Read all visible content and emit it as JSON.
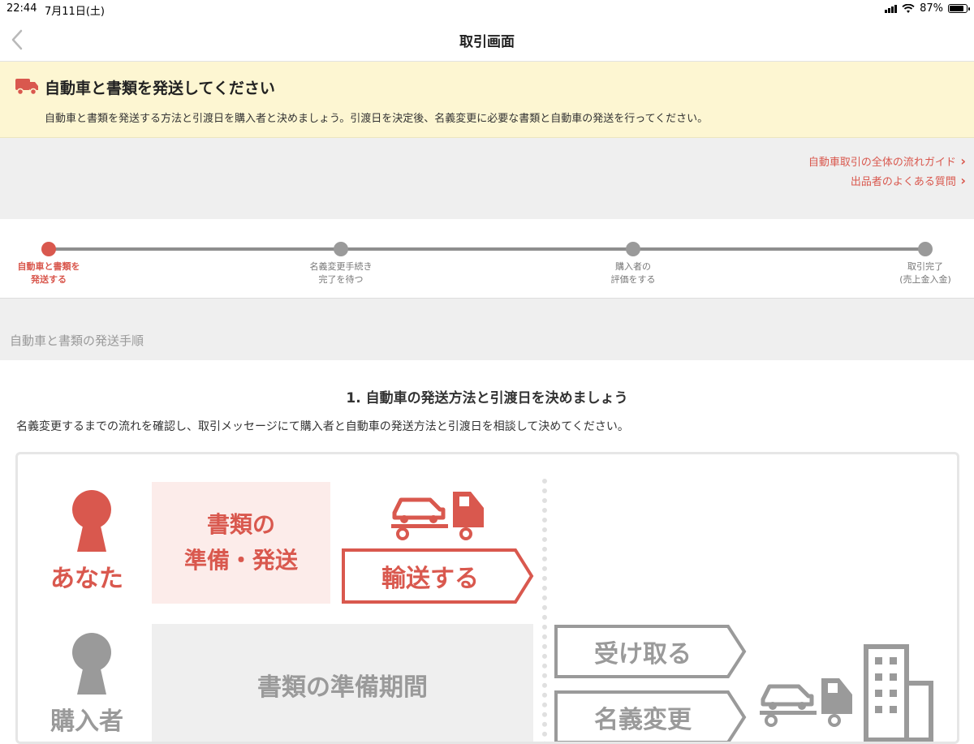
{
  "status": {
    "time": "22:44",
    "date": "7月11日(土)",
    "battery": "87%",
    "battery_level": 0.87
  },
  "nav": {
    "title": "取引画面"
  },
  "notice": {
    "title": "自動車と書類を発送してください",
    "text": "自動車と書類を発送する方法と引渡日を購入者と決めましょう。引渡日を決定後、名義変更に必要な書類と自動車の発送を行ってください。"
  },
  "links": [
    "自動車取引の全体の流れガイド",
    "出品者のよくある質問"
  ],
  "steps": [
    {
      "label": "自動車と書類を\n発送する",
      "active": true
    },
    {
      "label": "名義変更手続き\n完了を待つ",
      "active": false
    },
    {
      "label": "購入者の\n評価をする",
      "active": false
    },
    {
      "label": "取引完了\n(売上金入金)",
      "active": false
    }
  ],
  "section_header": "自動車と書類の発送手順",
  "main": {
    "heading": "1. 自動車の発送方法と引渡日を決めましょう",
    "description": "名義変更するまでの流れを確認し、取引メッセージにて購入者と自動車の発送方法と引渡日を相談して決めてください。"
  },
  "diagram": {
    "you_label": "あなた",
    "buyer_label": "購入者",
    "docs_box": "書類の\n準備・発送",
    "transport_label": "輸送する",
    "wait_box": "書類の準備期間",
    "receive_label": "受け取る",
    "name_change_label": "名義変更"
  },
  "colors": {
    "accent": "#d9584e",
    "notice_bg": "#fdf6d2",
    "gray": "#9a9a9a"
  }
}
